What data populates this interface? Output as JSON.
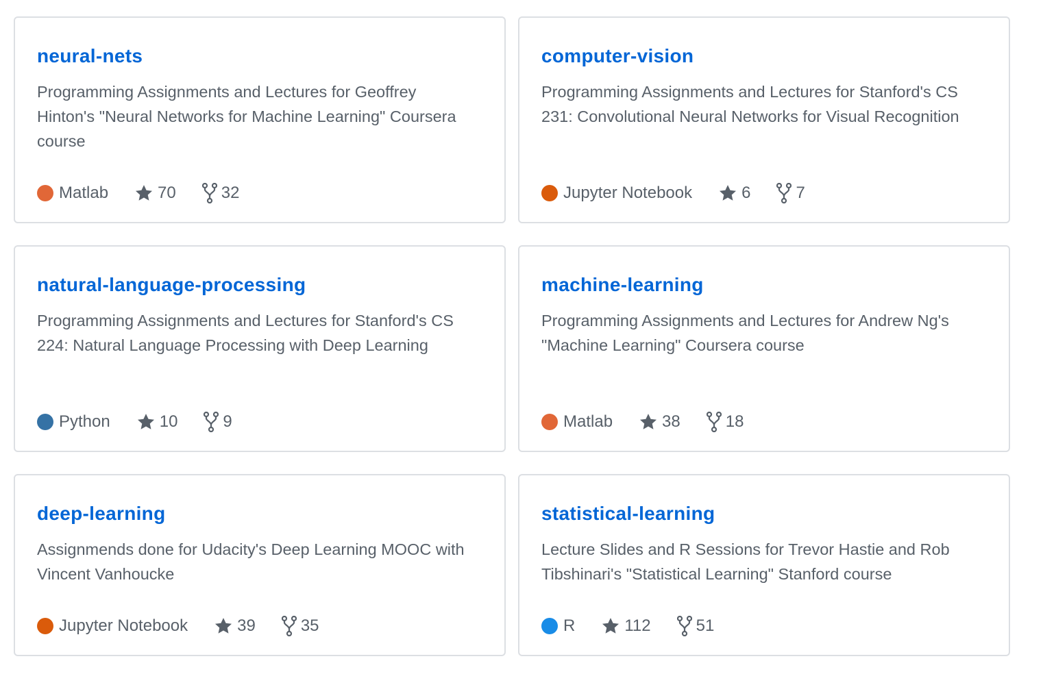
{
  "repos": [
    {
      "name": "neural-nets",
      "description": "Programming Assignments and Lectures for Geoffrey Hinton's \"Neural Networks for Machine Learning\" Coursera course",
      "language": "Matlab",
      "language_color": "#e16737",
      "stars": "70",
      "forks": "32"
    },
    {
      "name": "computer-vision",
      "description": "Programming Assignments and Lectures for Stanford's CS 231: Convolutional Neural Networks for Visual Recognition",
      "language": "Jupyter Notebook",
      "language_color": "#da5b0b",
      "stars": "6",
      "forks": "7"
    },
    {
      "name": "natural-language-processing",
      "description": "Programming Assignments and Lectures for Stanford's CS 224: Natural Language Processing with Deep Learning",
      "language": "Python",
      "language_color": "#3572a5",
      "stars": "10",
      "forks": "9"
    },
    {
      "name": "machine-learning",
      "description": "Programming Assignments and Lectures for Andrew Ng's \"Machine Learning\" Coursera course",
      "language": "Matlab",
      "language_color": "#e16737",
      "stars": "38",
      "forks": "18"
    },
    {
      "name": "deep-learning",
      "description": "Assignmends done for Udacity's Deep Learning MOOC with Vincent Vanhoucke",
      "language": "Jupyter Notebook",
      "language_color": "#da5b0b",
      "stars": "39",
      "forks": "35"
    },
    {
      "name": "statistical-learning",
      "description": "Lecture Slides and R Sessions for Trevor Hastie and Rob Tibshinari's \"Statistical Learning\" Stanford course",
      "language": "R",
      "language_color": "#198ce7",
      "stars": "112",
      "forks": "51"
    }
  ],
  "icons": {
    "star": "star-icon",
    "fork": "repo-forked-icon"
  },
  "colors": {
    "link": "#0366d6",
    "text": "#586069",
    "border": "#dcdfe3"
  }
}
